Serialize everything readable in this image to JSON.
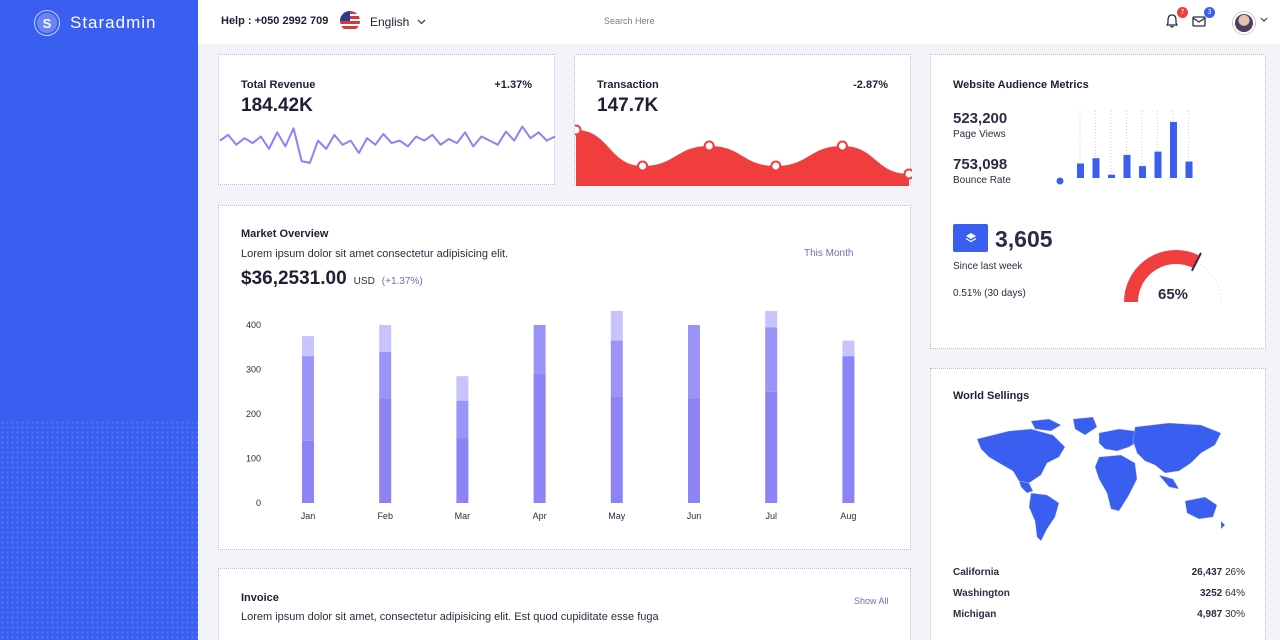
{
  "app": {
    "name": "Staradmin",
    "logo_letter": "S"
  },
  "topbar": {
    "help": "Help : +050 2992 709",
    "language": "English",
    "search_placeholder": "Search Here",
    "notifications_count": "7",
    "messages_count": "3"
  },
  "colors": {
    "primary": "#3a5ef0",
    "accent_purple": "#8b83f6",
    "danger": "#f03e3e"
  },
  "revenue": {
    "title": "Total Revenue",
    "value": "184.42K",
    "change": "+1.37%"
  },
  "transaction": {
    "title": "Transaction",
    "value": "147.7K",
    "change": "-2.87%"
  },
  "market": {
    "title": "Market Overview",
    "desc": "Lorem ipsum dolor sit amet consectetur adipisicing elit.",
    "period": "This Month",
    "amount": "$36,2531.00",
    "currency": "USD",
    "change": "(+1.37%)"
  },
  "audience": {
    "title": "Website Audience Metrics",
    "page_views_value": "523,200",
    "page_views_label": "Page Views",
    "bounce_value": "753,098",
    "bounce_label": "Bounce Rate",
    "weekly_value": "3,605",
    "weekly_label": "Since last week",
    "monthly_change": "0.51% (30 days)",
    "gauge_value": "65%",
    "gauge_percent": 65,
    "bar_values": [
      22,
      30,
      5,
      35,
      18,
      40,
      85,
      25
    ]
  },
  "world": {
    "title": "World Sellings",
    "rows": [
      {
        "state": "California",
        "value": "26,437",
        "pct": "26%"
      },
      {
        "state": "Washington",
        "value": "3252",
        "pct": "64%"
      },
      {
        "state": "Michigan",
        "value": "4,987",
        "pct": "30%"
      }
    ]
  },
  "invoice": {
    "title": "Invoice",
    "desc": "Lorem ipsum dolor sit amet, consectetur adipisicing elit. Est quod cupiditate esse fuga",
    "show_all": "Show All"
  },
  "chart_data": [
    {
      "type": "line",
      "title": "Total Revenue",
      "values": [
        55,
        62,
        50,
        58,
        52,
        60,
        45,
        65,
        48,
        70,
        30,
        28,
        55,
        45,
        62,
        50,
        55,
        40,
        58,
        50,
        63,
        52,
        55,
        48,
        60,
        55,
        62,
        50,
        57,
        52,
        65,
        48,
        60,
        55,
        50,
        66,
        55,
        72,
        58,
        65,
        55,
        60
      ]
    },
    {
      "type": "area",
      "title": "Transaction",
      "values": [
        60,
        15,
        40,
        15,
        40,
        5
      ]
    },
    {
      "type": "bar",
      "title": "Market Overview",
      "categories": [
        "Jan",
        "Feb",
        "Mar",
        "Apr",
        "May",
        "Jun",
        "Jul",
        "Aug"
      ],
      "series": [
        {
          "values": [
            140,
            235,
            145,
            290,
            240,
            235,
            250,
            330
          ]
        },
        {
          "values": [
            190,
            105,
            85,
            110,
            125,
            165,
            145,
            0
          ]
        },
        {
          "values": [
            45,
            60,
            55,
            0,
            85,
            0,
            60,
            35
          ]
        }
      ],
      "ylim": [
        0,
        400
      ],
      "yticks": [
        "0",
        "100",
        "200",
        "300",
        "400"
      ]
    }
  ]
}
